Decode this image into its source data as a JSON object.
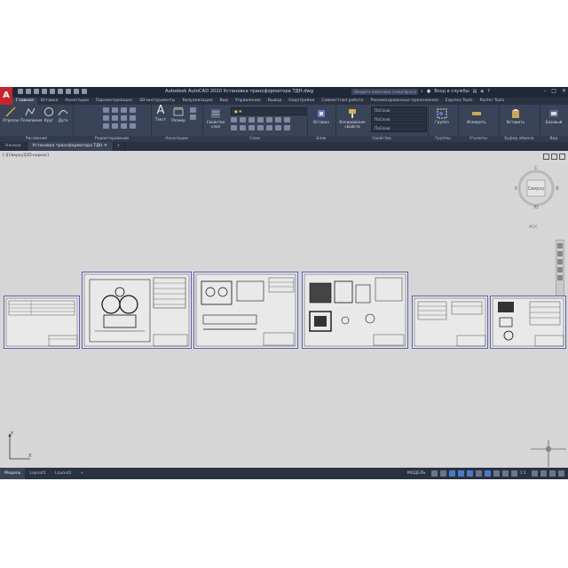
{
  "titlebar": {
    "logo": "A",
    "title": "Autodesk AutoCAD 2020   Установка трансформатора ТДН.dwg",
    "search_placeholder": "Введите ключевое слово/фразу",
    "user": "Вход в службы",
    "help": "?"
  },
  "ribbon_tabs": [
    "Главная",
    "Вставка",
    "Аннотации",
    "Параметризация",
    "3D-инструменты",
    "Визуализация",
    "Вид",
    "Управление",
    "Вывод",
    "Надстройки",
    "Совместная работа",
    "Рекомендованные приложения",
    "Express Tools",
    "Raster Tools"
  ],
  "panels": {
    "draw": {
      "title": "Рисование",
      "tools": [
        "Отрезок",
        "Полилиния",
        "Круг",
        "Дуга"
      ]
    },
    "modify": {
      "title": "Редактирование"
    },
    "annotation": {
      "title": "Аннотации",
      "tools": [
        "Текст",
        "Размер"
      ]
    },
    "layers": {
      "title": "Слои",
      "tools": [
        "Свойства слоя"
      ]
    },
    "block": {
      "title": "Блок",
      "tools": [
        "Вставка"
      ]
    },
    "properties": {
      "title": "Свойства",
      "tools": [
        "Копирование свойств"
      ],
      "combos": [
        "ПоСлою",
        "ПоСлою",
        "ПоСлою"
      ]
    },
    "groups": {
      "title": "Группы",
      "tools": [
        "Группа"
      ]
    },
    "utilities": {
      "title": "Утилиты",
      "tools": [
        "Измерить"
      ]
    },
    "clipboard": {
      "title": "Буфер обмена",
      "tools": [
        "Вставить"
      ]
    },
    "view": {
      "title": "Вид",
      "tools": [
        "Базовый"
      ]
    }
  },
  "doc_tabs": [
    "Начало",
    "Установка трансформатора ТДН"
  ],
  "viewport": {
    "label": "[-][Сверху][2D-каркас]",
    "viewcube_face": "Сверху",
    "compass": {
      "n": "С",
      "e": "В",
      "w": "З",
      "s": "Ю"
    },
    "wcs": "МСК"
  },
  "ucs": {
    "x": "X",
    "y": "Y"
  },
  "layout_tabs": [
    "Модель",
    "Layout1",
    "Layout2"
  ],
  "status": {
    "model": "МОДЕЛЬ",
    "scale": "1:1"
  }
}
